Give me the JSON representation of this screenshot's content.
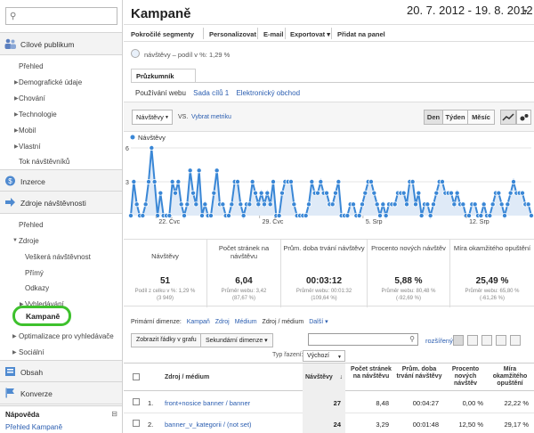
{
  "sidebar": {
    "search_placeholder": "",
    "sections": [
      {
        "label": "Cílové publikum"
      },
      {
        "label": "Inzerce"
      },
      {
        "label": "Zdroje návštěvnosti"
      },
      {
        "label": "Obsah"
      },
      {
        "label": "Konverze"
      }
    ],
    "audience_items": [
      "Přehled",
      "Demografické údaje",
      "Chování",
      "Technologie",
      "Mobil",
      "Vlastní",
      "Tok návštěvníků"
    ],
    "traffic_items": [
      "Přehled",
      "Zdroje",
      "Veškerá návštěvnost",
      "Přímý",
      "Odkazy",
      "Vyhledávání",
      "Kampaně",
      "Optimalizace pro vyhledávače",
      "Sociální"
    ],
    "help_title": "Nápověda",
    "help_link": "Přehled Kampaně",
    "help_toggle": "⊟"
  },
  "header": {
    "title": "Kampaně",
    "date_range": "20. 7. 2012 - 19. 8. 2012"
  },
  "toolbar": {
    "advanced_segments": "Pokročilé segmenty",
    "personalize": "Personalizovat",
    "email": "E-mail",
    "export": "Exportovat ▾",
    "add_to_dashboard": "Přidat na panel"
  },
  "segment": {
    "text": "návštěvy – podíl v %: 1,29 %"
  },
  "explorer": {
    "tab": "Průzkumník",
    "subtabs": [
      "Používání webu",
      "Sada cílů 1",
      "Elektronický obchod"
    ]
  },
  "metric_bar": {
    "metric": "Návštěvy",
    "vs": "VS.",
    "pick_metric": "Vybrat metriku",
    "granularity": [
      "Den",
      "Týden",
      "Měsíc"
    ],
    "active_granularity": "Den"
  },
  "chart_data": {
    "type": "area",
    "series": [
      {
        "name": "Návštěvy",
        "values": [
          0,
          3,
          1,
          0,
          0,
          1,
          3,
          6,
          3,
          0,
          2,
          0,
          0,
          0,
          3,
          2,
          3,
          1,
          0,
          1,
          4,
          2,
          1,
          4,
          0,
          1,
          0,
          0,
          2,
          4,
          1,
          1,
          0,
          0,
          1,
          3,
          3,
          1,
          0,
          1,
          1,
          3,
          2,
          1,
          2,
          1,
          2,
          1,
          3,
          0,
          0,
          2,
          3,
          3,
          3,
          1,
          0,
          0,
          0,
          0,
          1,
          3,
          2,
          2,
          3,
          2,
          2,
          1,
          1,
          2,
          3,
          0,
          0,
          0,
          1,
          1,
          0,
          0,
          1,
          2,
          3,
          3,
          2,
          1,
          0,
          1,
          0,
          1,
          1,
          1,
          2,
          2,
          2,
          1,
          3,
          3,
          1,
          2,
          0,
          1,
          1,
          0,
          1,
          2,
          3,
          3,
          2,
          2,
          2,
          1,
          2,
          1,
          1,
          0,
          0,
          1,
          1,
          0,
          0,
          1,
          0,
          0,
          1,
          2,
          2,
          1,
          0,
          1,
          2,
          3,
          2,
          2,
          2,
          1,
          1,
          0
        ]
      }
    ],
    "ylim": [
      0,
      6
    ],
    "yticks": [
      "6",
      "3"
    ],
    "xtick_labels": [
      "22. Čvc",
      "29. Čvc",
      "5. Srp",
      "12. Srp"
    ],
    "legend": "Návštěvy",
    "grid": true,
    "color": "#3a87d6"
  },
  "scorecards": [
    {
      "label": "Návštěvy",
      "value": "51",
      "sub1": "Podíl z celku v %: 1,29 %",
      "sub2": "(3 949)"
    },
    {
      "label": "Počet stránek na návštěvu",
      "value": "6,04",
      "sub1": "Průměr webu: 3,42",
      "sub2": "(87,67 %)"
    },
    {
      "label": "Prům. doba trvání návštěvy",
      "value": "00:03:12",
      "sub1": "Průměr webu: 00:01:32",
      "sub2": "(109,64 %)"
    },
    {
      "label": "Procento nových návštěv",
      "value": "5,88 %",
      "sub1": "Průměr webu: 80,48 %",
      "sub2": "(-92,69 %)"
    },
    {
      "label": "Míra okamžitého opuštění",
      "value": "25,49 %",
      "sub1": "Průměr webu: 65,80 %",
      "sub2": "(-61,26 %)"
    }
  ],
  "dimensions": {
    "label": "Primární dimenze:",
    "items": [
      "Kampaň",
      "Zdroj",
      "Médium",
      "Zdroj / médium",
      "Další ▾"
    ],
    "active": "Zdroj / médium"
  },
  "table_toolbar": {
    "plot_rows": "Zobrazit řádky v grafu",
    "secondary_dim": "Sekundární dimenze ▾",
    "advanced": "rozšířený",
    "sort_label": "Typ řazení:",
    "sort_value": "Výchozí"
  },
  "table": {
    "headers": [
      "Zdroj / médium",
      "Návštěvy",
      "Počet stránek na návštěvu",
      "Prům. doba trvání návštěvy",
      "Procento nových návštěv",
      "Míra okamžitého opuštění"
    ],
    "sort_arrow": "↓",
    "rows": [
      {
        "num": "1.",
        "label": "front+nosice banner / banner",
        "visits": "27",
        "pages": "8,48",
        "duration": "00:04:27",
        "new": "0,00 %",
        "bounce": "22,22 %"
      },
      {
        "num": "2.",
        "label": "banner_v_kategorii / (not set)",
        "visits": "24",
        "pages": "3,29",
        "duration": "00:01:48",
        "new": "12,50 %",
        "bounce": "29,17 %"
      }
    ]
  },
  "colors": {
    "accent_link": "#2a5db0",
    "highlight_ring": "#3ec12d",
    "chart_line": "#3a87d6"
  }
}
